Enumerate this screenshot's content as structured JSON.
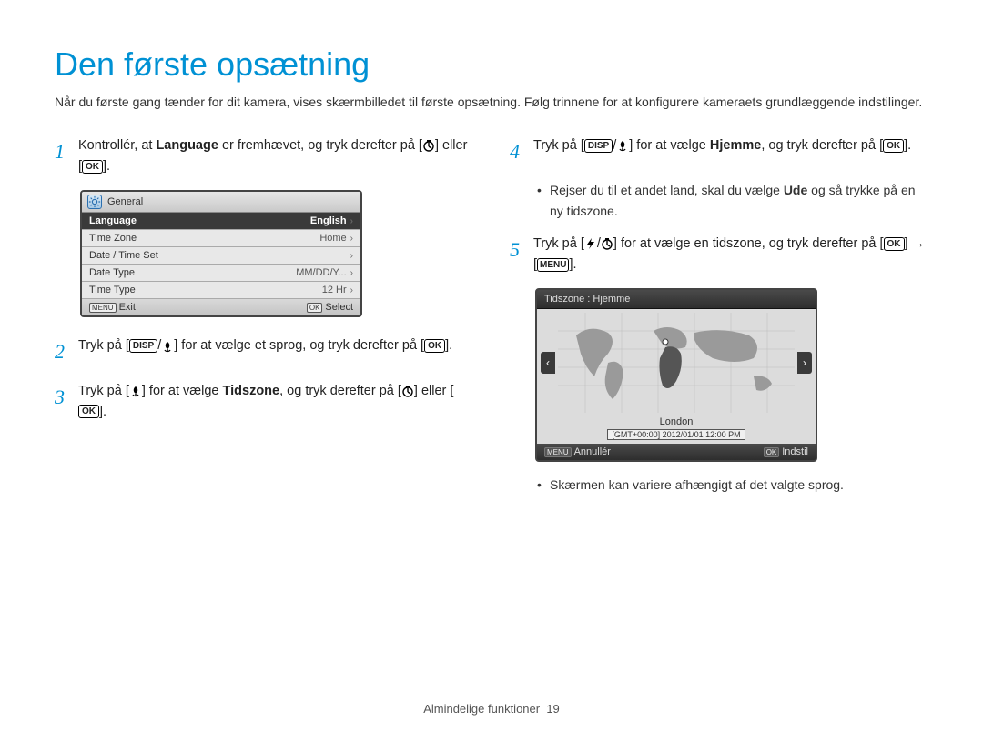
{
  "title": "Den første opsætning",
  "intro": "Når du første gang tænder for dit kamera, vises skærmbilledet til første opsætning. Følg trinnene for at konfigurere kameraets grundlæggende indstilinger.",
  "labels": {
    "ok": "OK",
    "disp": "DISP",
    "menu": "MENU"
  },
  "steps": {
    "s1a": "Kontrollér, at ",
    "s1b": "Language",
    "s1c": " er fremhævet, og tryk derefter på [",
    "s1d": "] eller [",
    "s1e": "].",
    "s2a": "Tryk på [",
    "s2b": "] for at vælge et sprog, og tryk derefter på [",
    "s2c": "].",
    "s3a": "Tryk på [",
    "s3b": "] for at vælge ",
    "s3c": "Tidszone",
    "s3d": ", og tryk derefter på [",
    "s3e": "] eller [",
    "s3f": "].",
    "s4a": "Tryk på [",
    "s4b": "] for at vælge ",
    "s4c": "Hjemme",
    "s4d": ", og tryk derefter på [",
    "s4e": "].",
    "s4note_a": "Rejser du til et andet land, skal du vælge ",
    "s4note_b": "Ude",
    "s4note_c": " og så trykke på en ny tidszone.",
    "s5a": "Tryk på [",
    "s5b": "] for at vælge en tidszone, og tryk derefter på [",
    "s5c": "] → [",
    "s5d": "].",
    "s5note": "Skærmen kan variere afhængigt af det valgte sprog."
  },
  "lcd1": {
    "header": "General",
    "rows": [
      {
        "k": "Language",
        "v": "English"
      },
      {
        "k": "Time Zone",
        "v": "Home"
      },
      {
        "k": "Date / Time Set",
        "v": ""
      },
      {
        "k": "Date Type",
        "v": "MM/DD/Y..."
      },
      {
        "k": "Time Type",
        "v": "12 Hr"
      }
    ],
    "exit": "Exit",
    "select": "Select",
    "menu_tag": "MENU",
    "ok_tag": "OK"
  },
  "lcd2": {
    "header": "Tidszone : Hjemme",
    "city": "London",
    "gmt": "[GMT+00:00] 2012/01/01 12:00 PM",
    "cancel": "Annullér",
    "set": "Indstil",
    "menu_tag": "MENU",
    "ok_tag": "OK"
  },
  "footer": {
    "section": "Almindelige funktioner",
    "page": "19"
  }
}
